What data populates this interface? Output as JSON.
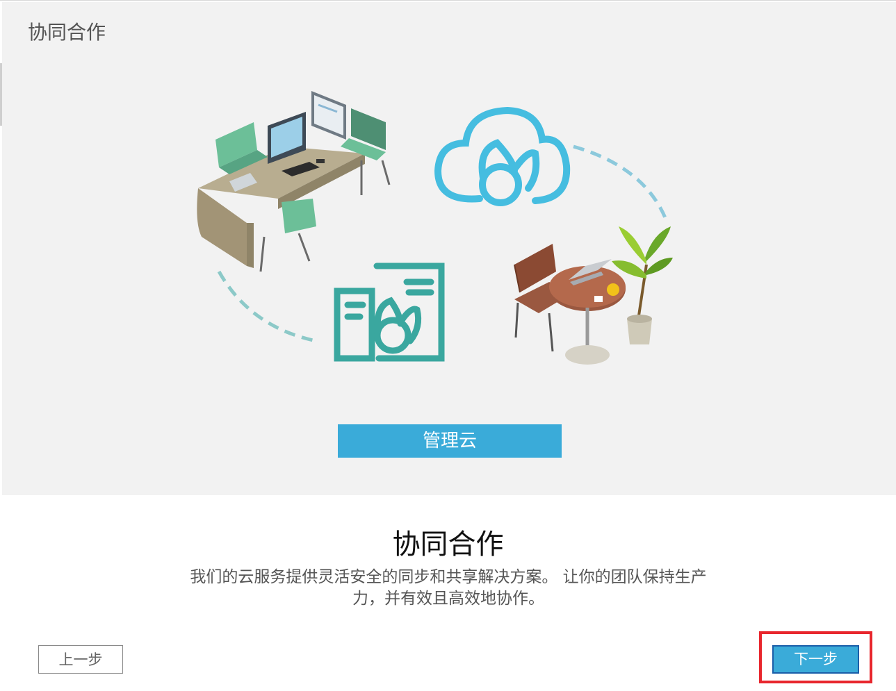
{
  "window": {
    "title": "协同合作"
  },
  "hero": {
    "cloud_button_label": "管理云"
  },
  "content": {
    "heading": "协同合作",
    "description_line1": "我们的云服务提供灵活安全的同步和共享解决方案。 让你的团队保持生产",
    "description_line2": "力，并有效且高效地协作。"
  },
  "footer": {
    "prev_label": "上一步",
    "next_label": "下一步"
  },
  "colors": {
    "accent": "#3aabd9",
    "teal": "#3aa79f",
    "highlight": "#e8262d",
    "hero_bg": "#f2f2f2"
  }
}
